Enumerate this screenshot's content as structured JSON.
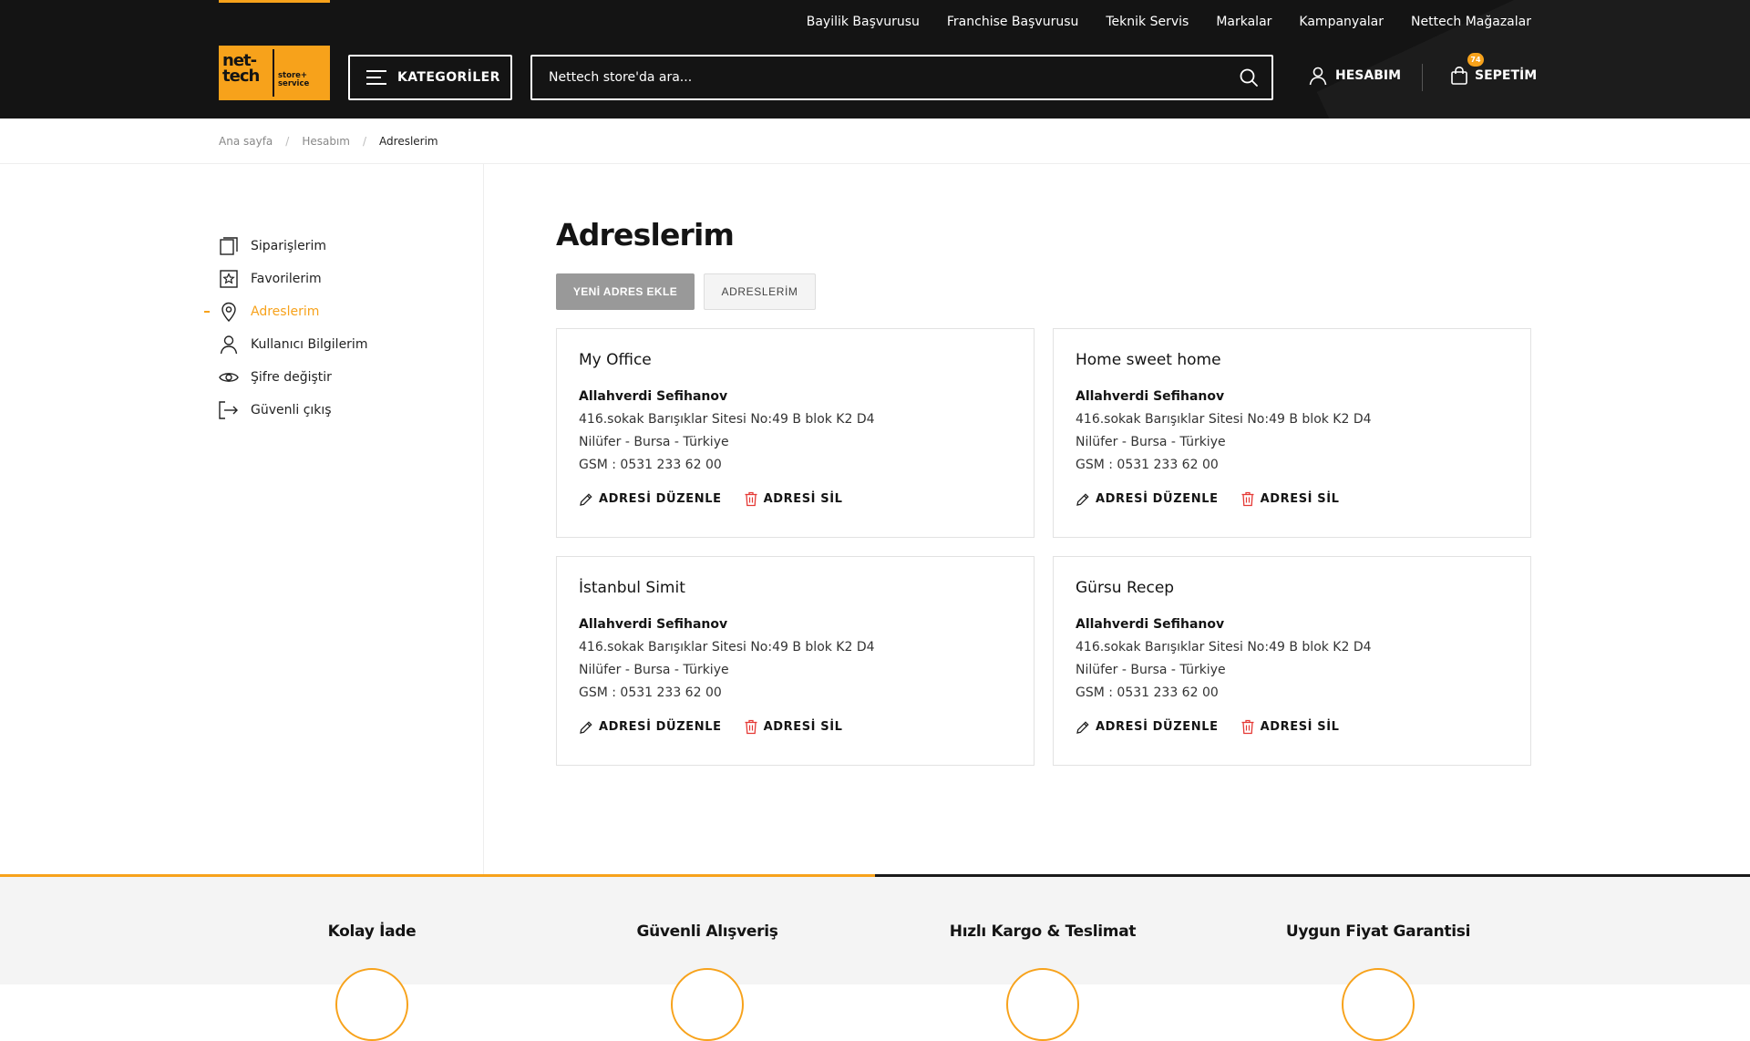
{
  "header": {
    "top_links": [
      "Bayilik Başvurusu",
      "Franchise Başvurusu",
      "Teknik Servis",
      "Markalar",
      "Kampanyalar",
      "Nettech Mağazalar"
    ],
    "logo_main": "net-\ntech",
    "logo_sub": "store+\nservice",
    "categories_label": "KATEGORİLER",
    "search_placeholder": "Nettech store'da ara...",
    "account_label": "HESABIM",
    "cart_label": "SEPETİM",
    "cart_count": "74"
  },
  "breadcrumb": [
    "Ana sayfa",
    "Hesabım",
    "Adreslerim"
  ],
  "sidebar": {
    "items": [
      {
        "label": "Siparişlerim",
        "icon": "orders-icon",
        "active": false
      },
      {
        "label": "Favorilerim",
        "icon": "star-icon",
        "active": false
      },
      {
        "label": "Adreslerim",
        "icon": "location-pin-icon",
        "active": true
      },
      {
        "label": "Kullanıcı Bilgilerim",
        "icon": "user-icon",
        "active": false
      },
      {
        "label": "Şifre değiştir",
        "icon": "eye-icon",
        "active": false
      },
      {
        "label": "Güvenli çıkış",
        "icon": "logout-icon",
        "active": false
      }
    ]
  },
  "main": {
    "title": "Adreslerim",
    "new_address_label": "YENİ ADRES EKLE",
    "my_addresses_label": "ADRESLERİM",
    "edit_label": "ADRESİ DÜZENLE",
    "delete_label": "ADRESİ SİL",
    "addresses": [
      {
        "title": "My Office",
        "name": "Allahverdi Sefihanov",
        "street": "416.sokak Barışıklar Sitesi No:49 B blok K2 D4",
        "city": "Nilüfer - Bursa - Türkiye",
        "phone": "GSM : 0531 233 62 00"
      },
      {
        "title": "Home sweet home",
        "name": "Allahverdi Sefihanov",
        "street": "416.sokak Barışıklar Sitesi No:49 B blok K2 D4",
        "city": "Nilüfer - Bursa - Türkiye",
        "phone": "GSM : 0531 233 62 00"
      },
      {
        "title": "İstanbul Simit",
        "name": "Allahverdi Sefihanov",
        "street": "416.sokak Barışıklar Sitesi No:49 B blok K2 D4",
        "city": "Nilüfer - Bursa - Türkiye",
        "phone": "GSM : 0531 233 62 00"
      },
      {
        "title": "Gürsu Recep",
        "name": "Allahverdi Sefihanov",
        "street": "416.sokak Barışıklar Sitesi No:49 B blok K2 D4",
        "city": "Nilüfer - Bursa - Türkiye",
        "phone": "GSM : 0531 233 62 00"
      }
    ]
  },
  "features": [
    "Kolay İade",
    "Güvenli Alışveriş",
    "Hızlı Kargo & Teslimat",
    "Uygun Fiyat Garantisi"
  ],
  "slider_progress": 0.5,
  "colors": {
    "accent": "#f7a21b",
    "header_bg": "#141414",
    "button_gray": "#999999",
    "delete_red": "#e53935"
  }
}
